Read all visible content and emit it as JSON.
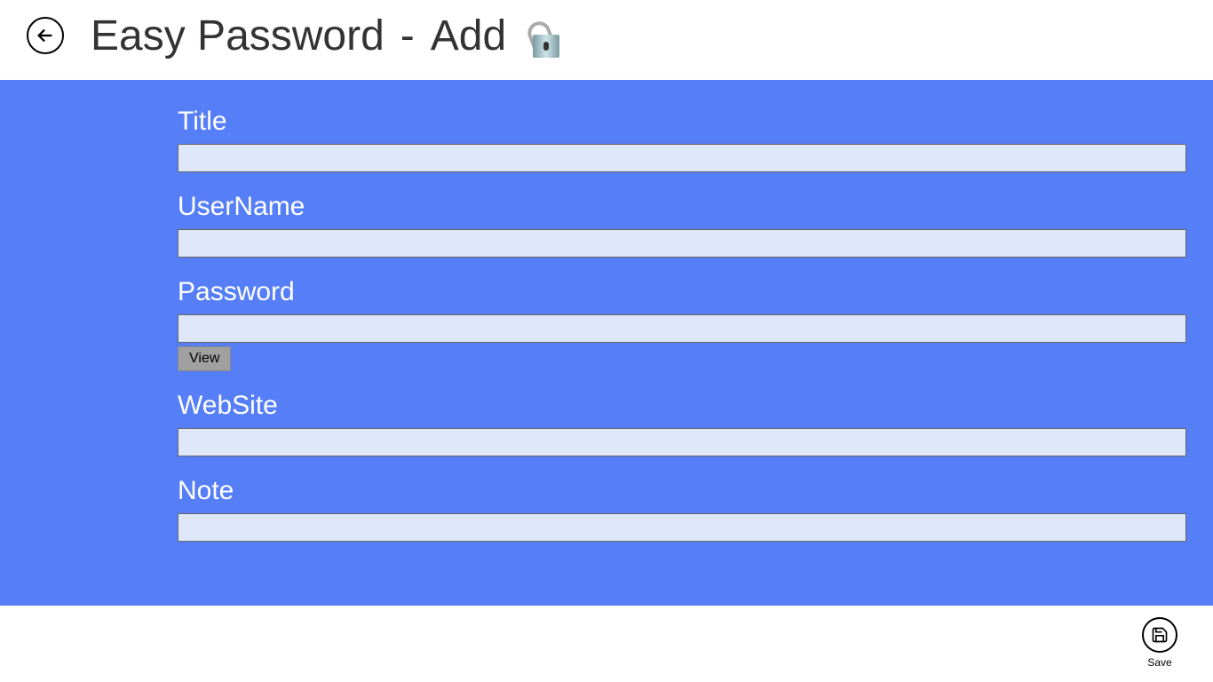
{
  "header": {
    "app_title": "Easy Password",
    "separator": "-",
    "page_title": "Add"
  },
  "form": {
    "title": {
      "label": "Title",
      "value": ""
    },
    "username": {
      "label": "UserName",
      "value": ""
    },
    "password": {
      "label": "Password",
      "value": "",
      "view_button": "View"
    },
    "website": {
      "label": "WebSite",
      "value": ""
    },
    "note": {
      "label": "Note",
      "value": ""
    }
  },
  "actions": {
    "save_label": "Save"
  }
}
